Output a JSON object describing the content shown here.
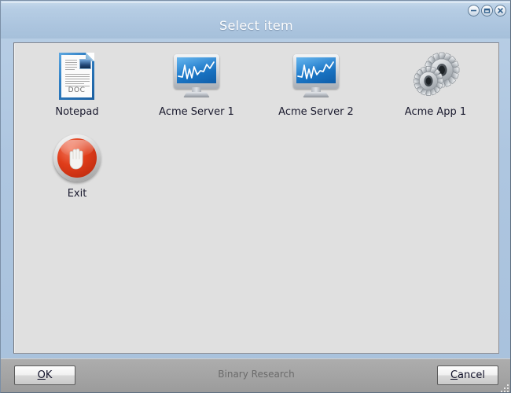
{
  "window": {
    "title": "Select item",
    "controls": [
      {
        "name": "minimize",
        "icon": "minimize-icon"
      },
      {
        "name": "maximize",
        "icon": "maximize-icon"
      },
      {
        "name": "close",
        "icon": "close-icon"
      }
    ],
    "colors": {
      "titlebar": "#aec6e0",
      "panel": "#e0e0e0",
      "footer": "#a3a3a3",
      "title_text": "#ffffff",
      "label_text": "#1a1a2e",
      "footer_text": "#6b6b6b",
      "exit_red": "#e03d1a",
      "screen_blue": "#1f7fd0"
    }
  },
  "items": [
    {
      "label": "Notepad",
      "icon": "document-doc-icon"
    },
    {
      "label": "Acme Server 1",
      "icon": "monitor-chart-icon"
    },
    {
      "label": "Acme Server 2",
      "icon": "monitor-chart-icon"
    },
    {
      "label": "Acme App 1",
      "icon": "gears-icon"
    },
    {
      "label": "Exit",
      "icon": "stop-hand-icon"
    }
  ],
  "document_icon": {
    "badge": "DOC"
  },
  "footer": {
    "note": "Binary Research",
    "ok_mnemonic": "O",
    "ok_rest": "K",
    "cancel_mnemonic": "C",
    "cancel_rest": "ancel",
    "ok_label": "OK",
    "cancel_label": "Cancel"
  }
}
